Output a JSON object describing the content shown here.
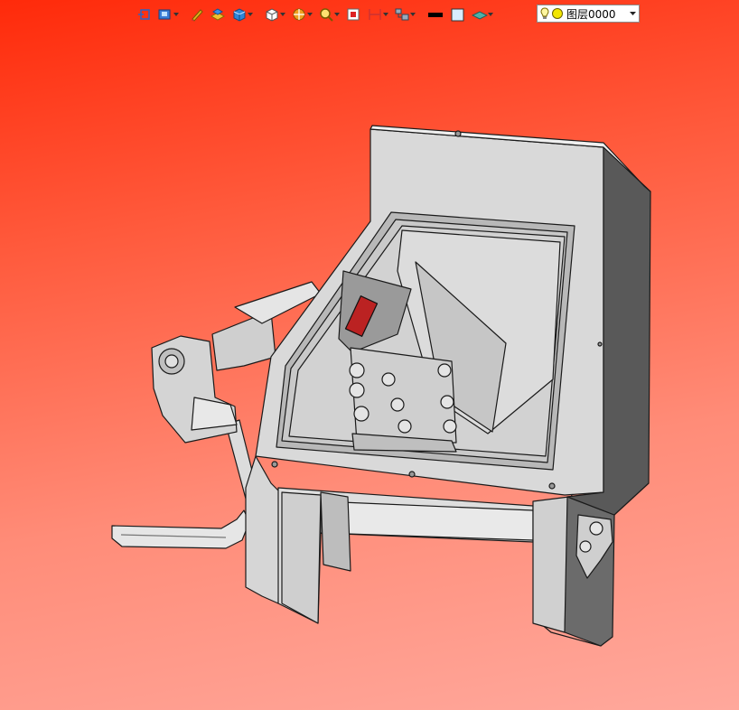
{
  "toolbar": {
    "buttons": [
      {
        "icon": "snap-point-icon",
        "has_dropdown": false
      },
      {
        "icon": "view-orientation-icon",
        "has_dropdown": true
      },
      {
        "icon": "pen-draw-icon",
        "has_dropdown": false
      },
      {
        "icon": "render-style-icon",
        "has_dropdown": false
      },
      {
        "icon": "shaded-solid-icon",
        "has_dropdown": true
      },
      {
        "icon": "standard-view-cube-icon",
        "has_dropdown": true
      },
      {
        "icon": "section-view-icon",
        "has_dropdown": true
      },
      {
        "icon": "zoom-icon",
        "has_dropdown": true
      },
      {
        "icon": "zoom-window-icon",
        "has_dropdown": false
      },
      {
        "icon": "dimension-icon",
        "has_dropdown": true
      },
      {
        "icon": "assembly-tree-icon",
        "has_dropdown": true
      },
      {
        "icon": "line-color-icon",
        "has_dropdown": false
      },
      {
        "icon": "fill-color-icon",
        "has_dropdown": false
      },
      {
        "icon": "layer-plane-icon",
        "has_dropdown": true
      }
    ],
    "layer": {
      "name": "图层0000",
      "visibility_icon": "lightbulb-icon",
      "status_color": "#f2e600"
    }
  },
  "colors": {
    "background_top": "#ff2a0a",
    "background_bottom": "#ffa89c",
    "machine_body": "#d9d9d9",
    "machine_side": "#595959",
    "machine_outline": "#1a1a1a"
  }
}
